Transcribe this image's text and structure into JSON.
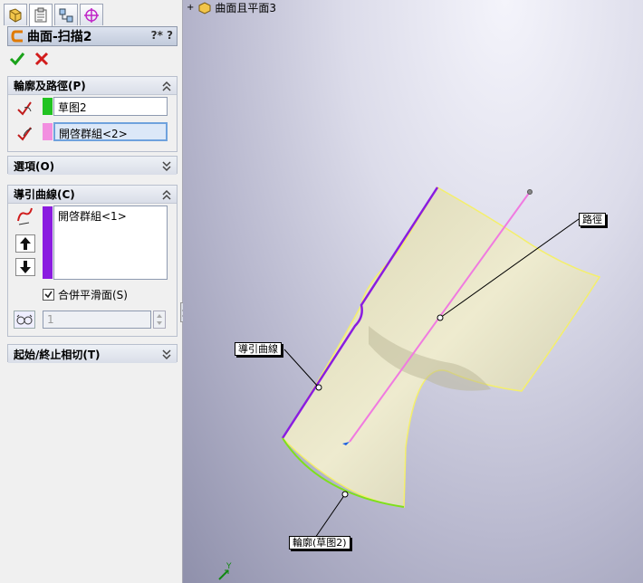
{
  "property_manager": {
    "title": "曲面-扫描2",
    "help": "?* ?",
    "profile_path": {
      "header": "輪廓及路徑(P)",
      "profile": "草图2",
      "path": "開啓群組<2>"
    },
    "options": {
      "header": "選項(O)"
    },
    "guide_curves": {
      "header": "導引曲線(C)",
      "items": [
        "開啓群組<1>"
      ],
      "merge_smooth_label": "合併平滑面(S)",
      "merge_smooth_checked": true,
      "spin_value": "1"
    },
    "start_end_tangency": {
      "header": "起始/終止相切(T)"
    }
  },
  "viewport": {
    "tree_node_label": "曲面且平面3",
    "callouts": {
      "path": "路徑",
      "guide_curve": "導引曲線",
      "profile": "輪廓(草图2)"
    },
    "triad_label": "Y"
  },
  "colors": {
    "profile_swatch": "#22c322",
    "path_swatch": "#f28ee0",
    "guide_swatch": "#8a1ce0",
    "surface": "#e4e1c0",
    "path_line": "#f07ae0",
    "guide_line": "#8a1ce0",
    "edge_line": "#f4ef6c"
  }
}
